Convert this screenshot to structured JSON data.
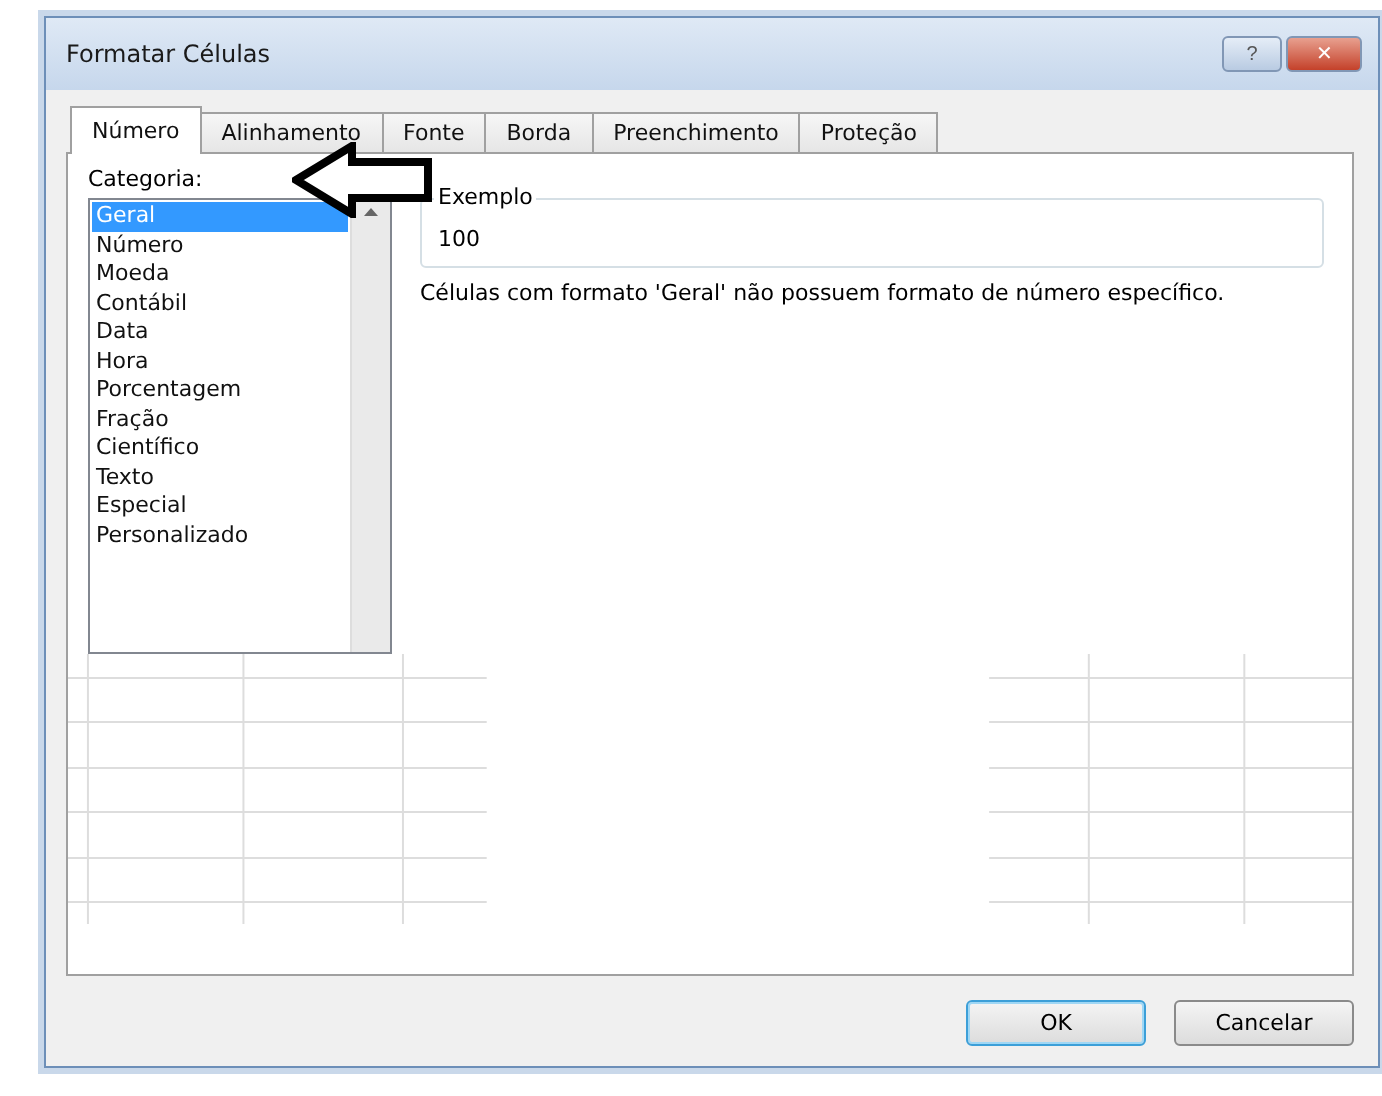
{
  "window": {
    "title": "Formatar Células"
  },
  "title_buttons": [
    {
      "kind": "help",
      "label": "?"
    },
    {
      "kind": "close",
      "label": "✕"
    }
  ],
  "tabs": [
    {
      "label": "Número",
      "selected": true
    },
    {
      "label": "Alinhamento",
      "selected": false
    },
    {
      "label": "Fonte",
      "selected": false
    },
    {
      "label": "Borda",
      "selected": false
    },
    {
      "label": "Preenchimento",
      "selected": false
    },
    {
      "label": "Proteção",
      "selected": false
    }
  ],
  "category": {
    "label": "Categoria:",
    "items": [
      {
        "label": "Geral",
        "selected": true
      },
      {
        "label": "Número",
        "selected": false
      },
      {
        "label": "Moeda",
        "selected": false
      },
      {
        "label": "Contábil",
        "selected": false
      },
      {
        "label": "Data",
        "selected": false
      },
      {
        "label": "Hora",
        "selected": false
      },
      {
        "label": "Porcentagem",
        "selected": false
      },
      {
        "label": "Fração",
        "selected": false
      },
      {
        "label": "Científico",
        "selected": false
      },
      {
        "label": "Texto",
        "selected": false
      },
      {
        "label": "Especial",
        "selected": false
      },
      {
        "label": "Personalizado",
        "selected": false
      }
    ]
  },
  "sample": {
    "label": "Exemplo",
    "value": "100"
  },
  "description": "Células com formato 'Geral' não possuem formato de número específico.",
  "buttons": [
    {
      "label": "OK",
      "default": true
    },
    {
      "label": "Cancelar",
      "default": false
    }
  ]
}
